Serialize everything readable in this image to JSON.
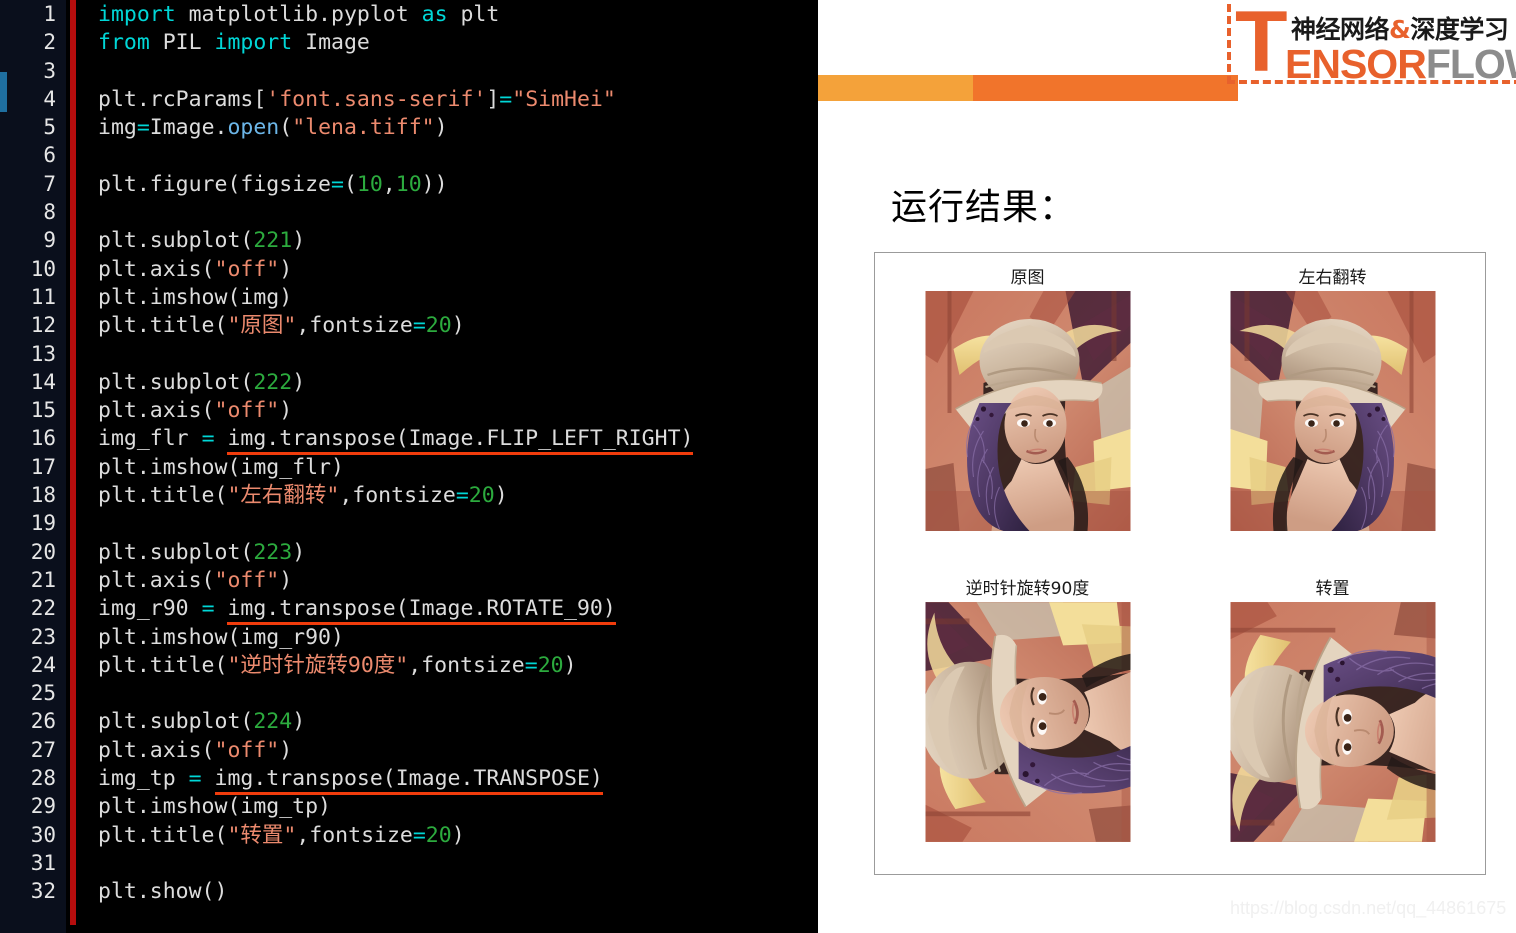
{
  "code_panel": {
    "language": "python",
    "background": "#000000",
    "gutter_background": "#0a0f1c",
    "marker_bar_color": "#b50d0d",
    "left_accent_color": "#1f6fa0",
    "underline_color": "#f03c0c",
    "colors": {
      "keyword": "#00d7d7",
      "identifier": "#dcdcdc",
      "function": "#6cb6e8",
      "string": "#ec8a6e",
      "number": "#2cab3e",
      "operator": "#00d7d7",
      "line_number": "#e6e6e6"
    },
    "lines": [
      {
        "n": "1",
        "tokens": [
          {
            "t": "import",
            "c": "kw"
          },
          {
            "t": " matplotlib.pyplot ",
            "c": "id"
          },
          {
            "t": "as",
            "c": "kw"
          },
          {
            "t": " plt",
            "c": "id"
          }
        ]
      },
      {
        "n": "2",
        "tokens": [
          {
            "t": "from",
            "c": "kw"
          },
          {
            "t": " PIL ",
            "c": "id"
          },
          {
            "t": "import",
            "c": "kw"
          },
          {
            "t": " Image",
            "c": "id"
          }
        ]
      },
      {
        "n": "3",
        "tokens": []
      },
      {
        "n": "4",
        "tokens": [
          {
            "t": "plt.rcParams[",
            "c": "id"
          },
          {
            "t": "'font.sans-serif'",
            "c": "str"
          },
          {
            "t": "]",
            "c": "id"
          },
          {
            "t": "=",
            "c": "op"
          },
          {
            "t": "\"SimHei\"",
            "c": "str"
          }
        ]
      },
      {
        "n": "5",
        "tokens": [
          {
            "t": "img",
            "c": "id"
          },
          {
            "t": "=",
            "c": "op"
          },
          {
            "t": "Image.",
            "c": "id"
          },
          {
            "t": "open",
            "c": "fn"
          },
          {
            "t": "(",
            "c": "id"
          },
          {
            "t": "\"lena.tiff\"",
            "c": "str"
          },
          {
            "t": ")",
            "c": "id"
          }
        ]
      },
      {
        "n": "6",
        "tokens": []
      },
      {
        "n": "7",
        "tokens": [
          {
            "t": "plt.figure(figsize",
            "c": "id"
          },
          {
            "t": "=",
            "c": "op"
          },
          {
            "t": "(",
            "c": "id"
          },
          {
            "t": "10",
            "c": "num"
          },
          {
            "t": ",",
            "c": "id"
          },
          {
            "t": "10",
            "c": "num"
          },
          {
            "t": "))",
            "c": "id"
          }
        ]
      },
      {
        "n": "8",
        "tokens": []
      },
      {
        "n": "9",
        "tokens": [
          {
            "t": "plt.subplot(",
            "c": "id"
          },
          {
            "t": "221",
            "c": "num"
          },
          {
            "t": ")",
            "c": "id"
          }
        ]
      },
      {
        "n": "10",
        "tokens": [
          {
            "t": "plt.axis(",
            "c": "id"
          },
          {
            "t": "\"off\"",
            "c": "str"
          },
          {
            "t": ")",
            "c": "id"
          }
        ]
      },
      {
        "n": "11",
        "tokens": [
          {
            "t": "plt.imshow(img)",
            "c": "id"
          }
        ]
      },
      {
        "n": "12",
        "tokens": [
          {
            "t": "plt.title(",
            "c": "id"
          },
          {
            "t": "\"原图\"",
            "c": "str"
          },
          {
            "t": ",fontsize",
            "c": "id"
          },
          {
            "t": "=",
            "c": "op"
          },
          {
            "t": "20",
            "c": "num"
          },
          {
            "t": ")",
            "c": "id"
          }
        ]
      },
      {
        "n": "13",
        "tokens": []
      },
      {
        "n": "14",
        "tokens": [
          {
            "t": "plt.subplot(",
            "c": "id"
          },
          {
            "t": "222",
            "c": "num"
          },
          {
            "t": ")",
            "c": "id"
          }
        ]
      },
      {
        "n": "15",
        "tokens": [
          {
            "t": "plt.axis(",
            "c": "id"
          },
          {
            "t": "\"off\"",
            "c": "str"
          },
          {
            "t": ")",
            "c": "id"
          }
        ]
      },
      {
        "n": "16",
        "tokens": [
          {
            "t": "img_flr ",
            "c": "id"
          },
          {
            "t": "=",
            "c": "op"
          },
          {
            "t": " ",
            "c": "id"
          },
          {
            "t": "img.transpose(Image.FLIP_LEFT_RIGHT)",
            "c": "id",
            "ul": true
          }
        ]
      },
      {
        "n": "17",
        "tokens": [
          {
            "t": "plt.imshow(img_flr)",
            "c": "id"
          }
        ]
      },
      {
        "n": "18",
        "tokens": [
          {
            "t": "plt.title(",
            "c": "id"
          },
          {
            "t": "\"左右翻转\"",
            "c": "str"
          },
          {
            "t": ",fontsize",
            "c": "id"
          },
          {
            "t": "=",
            "c": "op"
          },
          {
            "t": "20",
            "c": "num"
          },
          {
            "t": ")",
            "c": "id"
          }
        ]
      },
      {
        "n": "19",
        "tokens": []
      },
      {
        "n": "20",
        "tokens": [
          {
            "t": "plt.subplot(",
            "c": "id"
          },
          {
            "t": "223",
            "c": "num"
          },
          {
            "t": ")",
            "c": "id"
          }
        ]
      },
      {
        "n": "21",
        "tokens": [
          {
            "t": "plt.axis(",
            "c": "id"
          },
          {
            "t": "\"off\"",
            "c": "str"
          },
          {
            "t": ")",
            "c": "id"
          }
        ]
      },
      {
        "n": "22",
        "tokens": [
          {
            "t": "img_r90 ",
            "c": "id"
          },
          {
            "t": "=",
            "c": "op"
          },
          {
            "t": " ",
            "c": "id"
          },
          {
            "t": "img.transpose(Image.ROTATE_90)",
            "c": "id",
            "ul": true
          }
        ]
      },
      {
        "n": "23",
        "tokens": [
          {
            "t": "plt.imshow(img_r90)",
            "c": "id"
          }
        ]
      },
      {
        "n": "24",
        "tokens": [
          {
            "t": "plt.title(",
            "c": "id"
          },
          {
            "t": "\"逆时针旋转90度\"",
            "c": "str"
          },
          {
            "t": ",fontsize",
            "c": "id"
          },
          {
            "t": "=",
            "c": "op"
          },
          {
            "t": "20",
            "c": "num"
          },
          {
            "t": ")",
            "c": "id"
          }
        ]
      },
      {
        "n": "25",
        "tokens": []
      },
      {
        "n": "26",
        "tokens": [
          {
            "t": "plt.subplot(",
            "c": "id"
          },
          {
            "t": "224",
            "c": "num"
          },
          {
            "t": ")",
            "c": "id"
          }
        ]
      },
      {
        "n": "27",
        "tokens": [
          {
            "t": "plt.axis(",
            "c": "id"
          },
          {
            "t": "\"off\"",
            "c": "str"
          },
          {
            "t": ")",
            "c": "id"
          }
        ]
      },
      {
        "n": "28",
        "tokens": [
          {
            "t": "img_tp ",
            "c": "id"
          },
          {
            "t": "=",
            "c": "op"
          },
          {
            "t": " ",
            "c": "id"
          },
          {
            "t": "img.transpose(Image.TRANSPOSE)",
            "c": "id",
            "ul": true
          }
        ]
      },
      {
        "n": "29",
        "tokens": [
          {
            "t": "plt.imshow(img_tp)",
            "c": "id"
          }
        ]
      },
      {
        "n": "30",
        "tokens": [
          {
            "t": "plt.title(",
            "c": "id"
          },
          {
            "t": "\"转置\"",
            "c": "str"
          },
          {
            "t": ",fontsize",
            "c": "id"
          },
          {
            "t": "=",
            "c": "op"
          },
          {
            "t": "20",
            "c": "num"
          },
          {
            "t": ")",
            "c": "id"
          }
        ]
      },
      {
        "n": "31",
        "tokens": []
      },
      {
        "n": "32",
        "tokens": [
          {
            "t": "plt.show()",
            "c": "id"
          }
        ]
      }
    ]
  },
  "slide": {
    "bars": {
      "light_color": "#f4a23a",
      "dark_color": "#f1742b",
      "dash_color": "#e8612c"
    },
    "logo": {
      "letter": "T",
      "chinese": "神经网络",
      "amp": "&",
      "chinese2": "深度学习",
      "word_orange": "ENSOR",
      "word_gray": "FLOW",
      "orange": "#e8612c",
      "gray": "#8c8c8c"
    },
    "result_heading": "运行结果：",
    "watermark": "https://blog.csdn.net/qq_44861675"
  },
  "figure": {
    "border_color": "#9b9b9b",
    "cells": [
      {
        "title": "原图",
        "variant": "orig"
      },
      {
        "title": "左右翻转",
        "variant": "flip"
      },
      {
        "title": "逆时针旋转90度",
        "variant": "rot90"
      },
      {
        "title": "转置",
        "variant": "trans"
      }
    ]
  }
}
